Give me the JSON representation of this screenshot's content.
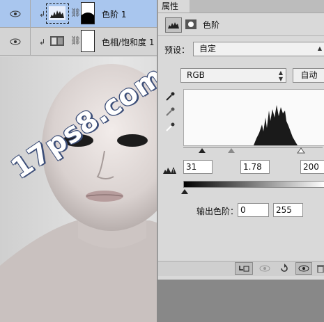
{
  "layers": [
    {
      "name": "色阶 1",
      "selected": true,
      "kind": "levels"
    },
    {
      "name": "色相/饱和度 1",
      "selected": false,
      "kind": "hue-saturation"
    }
  ],
  "properties": {
    "tab_label": "属性",
    "adjustment_title": "色阶",
    "preset_label": "预设：",
    "preset_value": "自定",
    "channel_value": "RGB",
    "auto_label": "自动",
    "input_black": "31",
    "input_gamma": "1.78",
    "input_white": "200",
    "output_label": "输出色阶：",
    "output_black": "0",
    "output_white": "255"
  },
  "watermark": "17ps8.com",
  "icons": [
    "eye-icon",
    "levels-icon",
    "hue-saturation-icon",
    "chain-icon",
    "mask-icon",
    "black-eyedropper-icon",
    "gray-eyedropper-icon",
    "white-eyedropper-icon",
    "clip-to-layer-icon",
    "view-previous-icon",
    "reset-icon",
    "visibility-icon",
    "delete-icon"
  ],
  "colors": {
    "selected_layer": "#a9c6ee",
    "panel_bg": "#d9d9d9"
  }
}
